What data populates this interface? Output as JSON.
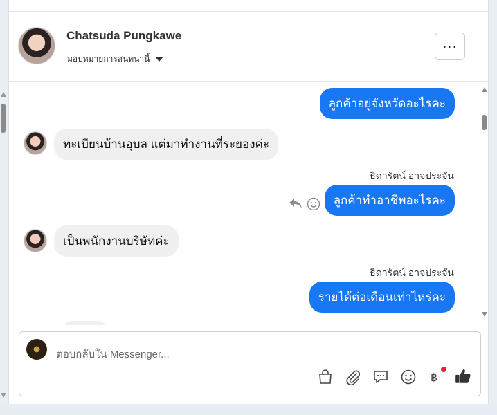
{
  "header": {
    "name": "Chatsuda Pungkawe",
    "assign_label": "มอบหมายการสนทนานี้",
    "more_label": "···"
  },
  "messages": [
    {
      "dir": "out",
      "text": "ลูกค้าอยู่จังหวัดอะไรคะ"
    },
    {
      "dir": "in",
      "text": "ทะเบียนบ้านอุบล แต่มาทำงานที่ระยองค่ะ"
    },
    {
      "dir": "out",
      "sender": "ธิดารัตน์ อาจประจัน",
      "text": "ลูกค้าทำอาชีพอะไรคะ"
    },
    {
      "dir": "in",
      "text": "เป็นพนักงานบริษัทค่ะ"
    },
    {
      "dir": "out",
      "sender": "ธิดารัตน์ อาจประจัน",
      "text": "รายได้ต่อเดือนเท่าไหร่คะ"
    }
  ],
  "composer": {
    "placeholder": "ตอบกลับใน Messenger..."
  },
  "colors": {
    "accent": "#1877f2",
    "incoming_bubble": "#f0f0f0",
    "notification": "#e41e3f"
  }
}
